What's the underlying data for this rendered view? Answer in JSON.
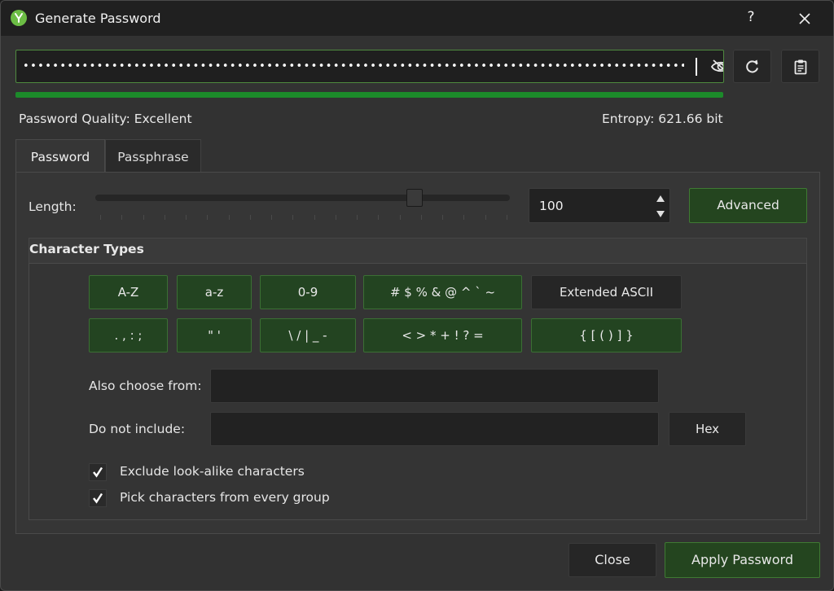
{
  "window": {
    "title": "Generate Password",
    "help_label": "?",
    "icons": {
      "app": "keepassxc-logo-icon",
      "close": "close-icon"
    }
  },
  "password": {
    "masked_value": "••••••••••••••••••••••••••••••••••••••••••••••••••••••••••••••••••••••••••••••••••••••••••••••••••••",
    "visibility_icon": "eye-slash-icon",
    "quality_fill": 1.0,
    "quality_color": "#1c8a2a",
    "quality_text": "Password Quality: Excellent",
    "entropy_text": "Entropy: 621.66 bit"
  },
  "side_buttons": {
    "regenerate_icon": "refresh-icon",
    "copy_icon": "clipboard-icon"
  },
  "tabs": [
    {
      "label": "Password",
      "active": true
    },
    {
      "label": "Passphrase",
      "active": false
    }
  ],
  "length": {
    "label": "Length:",
    "value": "100",
    "slider_fraction": 0.77,
    "advanced_label": "Advanced"
  },
  "character_types": {
    "title": "Character Types",
    "row1": [
      {
        "label": "A-Z",
        "checked": true
      },
      {
        "label": "a-z",
        "checked": true
      },
      {
        "label": "0-9",
        "checked": true
      },
      {
        "label": "# $ % & @ ^ ` ~",
        "checked": true
      },
      {
        "label": "Extended ASCII",
        "checked": false
      }
    ],
    "row2": [
      {
        "label": ". , : ;",
        "checked": true
      },
      {
        "label": "\" '",
        "checked": true
      },
      {
        "label": "\\ / | _ -",
        "checked": true
      },
      {
        "label": "< > * + ! ? =",
        "checked": true
      },
      {
        "label": "{ [ ( ) ] }",
        "checked": true
      }
    ]
  },
  "fields": {
    "also_choose_label": "Also choose from:",
    "also_choose_value": "",
    "exclude_label": "Do not include:",
    "exclude_value": "",
    "hex_label": "Hex"
  },
  "options": [
    {
      "label": "Exclude look-alike characters",
      "checked": true
    },
    {
      "label": "Pick characters from every group",
      "checked": true
    }
  ],
  "footer": {
    "close_label": "Close",
    "apply_label": "Apply Password"
  },
  "colors": {
    "accent_green": "#3f7a33",
    "toggle_on_bg": "#24451f",
    "window_bg": "#323232"
  }
}
